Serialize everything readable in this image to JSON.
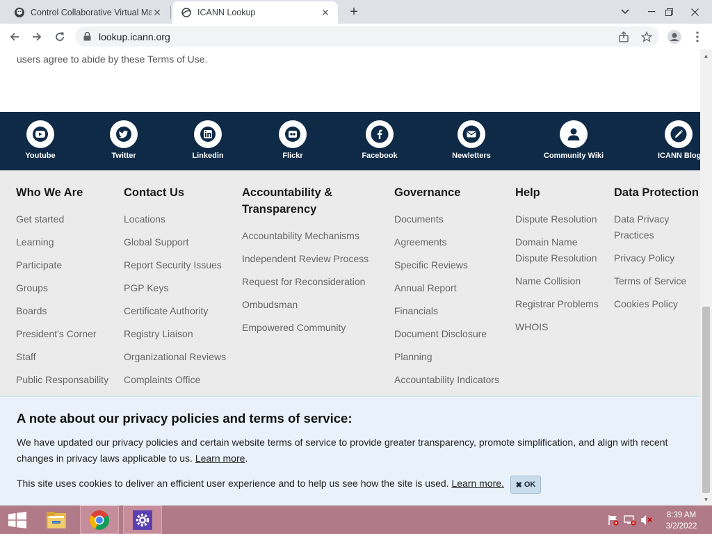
{
  "browser": {
    "tabs": [
      {
        "title": "Control Collaborative Virtual Ma",
        "icon": "puzzle-mask-icon",
        "active": false
      },
      {
        "title": "ICANN Lookup",
        "icon": "icann-globe-icon",
        "active": true
      }
    ],
    "url": "lookup.icann.org"
  },
  "page": {
    "terms_tail": "users agree to abide by these Terms of Use."
  },
  "social": [
    {
      "label": "Youtube",
      "icon": "youtube-icon"
    },
    {
      "label": "Twitter",
      "icon": "twitter-icon"
    },
    {
      "label": "Linkedin",
      "icon": "linkedin-icon"
    },
    {
      "label": "Flickr",
      "icon": "flickr-icon"
    },
    {
      "label": "Facebook",
      "icon": "facebook-icon"
    },
    {
      "label": "Newletters",
      "icon": "envelope-icon"
    },
    {
      "label": "Community Wiki",
      "icon": "user-icon"
    },
    {
      "label": "ICANN Blog",
      "icon": "pencil-icon"
    }
  ],
  "footer": {
    "columns": [
      {
        "heading": "Who We Are",
        "links": [
          "Get started",
          "Learning",
          "Participate",
          "Groups",
          "Boards",
          "President's Corner",
          "Staff",
          "Public Responsability"
        ]
      },
      {
        "heading": "Contact Us",
        "links": [
          "Locations",
          "Global Support",
          "Report Security Issues",
          "PGP Keys",
          "Certificate Authority",
          "Registry Liaison",
          "Organizational Reviews",
          "Complaints Office"
        ]
      },
      {
        "heading_line1": "Accountability &",
        "heading_line2": "Transparency",
        "links": [
          "Accountability Mechanisms",
          "Independent Review Process",
          "Request for Reconsideration",
          "Ombudsman",
          "Empowered Community"
        ]
      },
      {
        "heading": "Governance",
        "links": [
          "Documents",
          "Agreements",
          "Specific Reviews",
          "Annual Report",
          "Financials",
          "Document Disclosure",
          "Planning",
          "Accountability Indicators"
        ]
      },
      {
        "heading": "Help",
        "links": [
          "Dispute Resolution",
          "Domain Name",
          "Dispute Resolution",
          "Name Collision",
          "Registrar Problems",
          "WHOIS"
        ]
      },
      {
        "heading": "Data Protection",
        "links": [
          "Data Privacy",
          "Practices",
          "Privacy Policy",
          "Terms of Service",
          "Cookies Policy"
        ]
      }
    ]
  },
  "notice": {
    "title": "A note about our privacy policies and terms of service:",
    "p1_text": "We have updated our privacy policies and certain website terms of service to provide greater transparency, promote simplification, and align with recent changes in privacy laws applicable to us.",
    "p1_link": "Learn more",
    "p2_text": "This site uses cookies to deliver an efficient user experience and to help us see how the site is used.",
    "p2_link": "Learn more.",
    "ok_label": "OK"
  },
  "taskbar": {
    "time": "8:39 AM",
    "date": "3/2/2022"
  }
}
